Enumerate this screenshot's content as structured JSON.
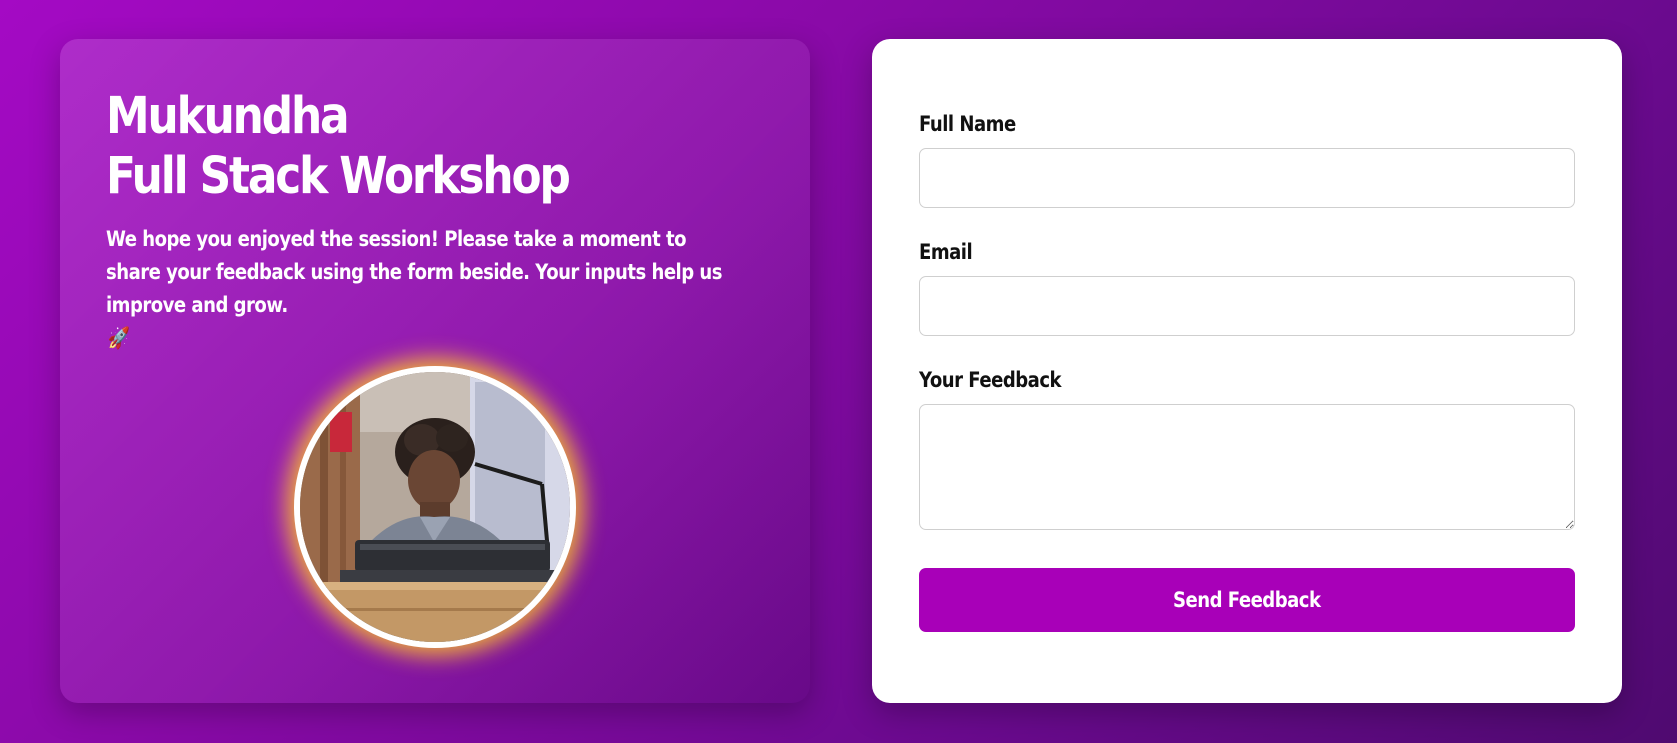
{
  "page": {
    "background_start": "#a40ac4",
    "background_end": "#4f0a70"
  },
  "hero": {
    "title_line1": "Mukundha",
    "title_line2": "Full Stack Workshop",
    "intro": "We hope you enjoyed the session! Please take a moment to share your feedback using the form beside. Your inputs help us improve and grow.",
    "intro_emoji": "🚀",
    "avatar_icon": "speaker-photo",
    "avatar_glow": "#ffc428"
  },
  "form": {
    "name_label": "Full Name",
    "name_value": "",
    "email_label": "Email",
    "email_value": "",
    "feedback_label": "Your Feedback",
    "feedback_value": "",
    "submit_label": "Send Feedback",
    "submit_color": "#a800b8"
  }
}
